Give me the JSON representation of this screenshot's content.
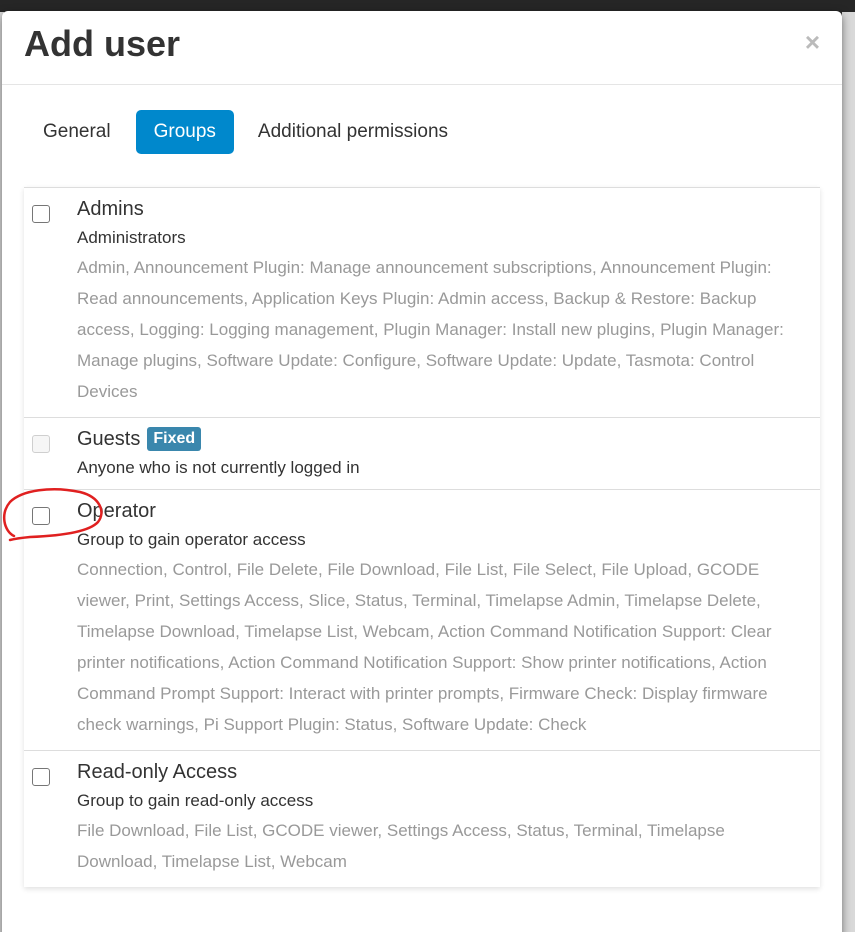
{
  "modal": {
    "title": "Add user",
    "close_label": "×"
  },
  "tabs": [
    {
      "label": "General",
      "active": false
    },
    {
      "label": "Groups",
      "active": true
    },
    {
      "label": "Additional permissions",
      "active": false
    }
  ],
  "groups": [
    {
      "name": "Admins",
      "badge": "",
      "description": "Administrators",
      "permissions": "Admin, Announcement Plugin: Manage announcement subscriptions, Announcement Plugin: Read announcements, Application Keys Plugin: Admin access, Backup & Restore: Backup access, Logging: Logging management, Plugin Manager: Install new plugins, Plugin Manager: Manage plugins, Software Update: Configure, Software Update: Update, Tasmota: Control Devices",
      "checked": false,
      "disabled": false
    },
    {
      "name": "Guests",
      "badge": "Fixed",
      "description": "Anyone who is not currently logged in",
      "permissions": "",
      "checked": false,
      "disabled": true
    },
    {
      "name": "Operator",
      "badge": "",
      "description": "Group to gain operator access",
      "permissions": "Connection, Control, File Delete, File Download, File List, File Select, File Upload, GCODE viewer, Print, Settings Access, Slice, Status, Terminal, Timelapse Admin, Timelapse Delete, Timelapse Download, Timelapse List, Webcam, Action Command Notification Support: Clear printer notifications, Action Command Notification Support: Show printer notifications, Action Command Prompt Support: Interact with printer prompts, Firmware Check: Display firmware check warnings, Pi Support Plugin: Status, Software Update: Check",
      "checked": false,
      "disabled": false
    },
    {
      "name": "Read-only Access",
      "badge": "",
      "description": "Group to gain read-only access",
      "permissions": "File Download, File List, GCODE viewer, Settings Access, Status, Terminal, Timelapse Download, Timelapse List, Webcam",
      "checked": false,
      "disabled": false
    }
  ],
  "colors": {
    "accent": "#0088cc",
    "badge": "#3a87ad",
    "muted_text": "#999999",
    "annotation": "#e02020"
  }
}
